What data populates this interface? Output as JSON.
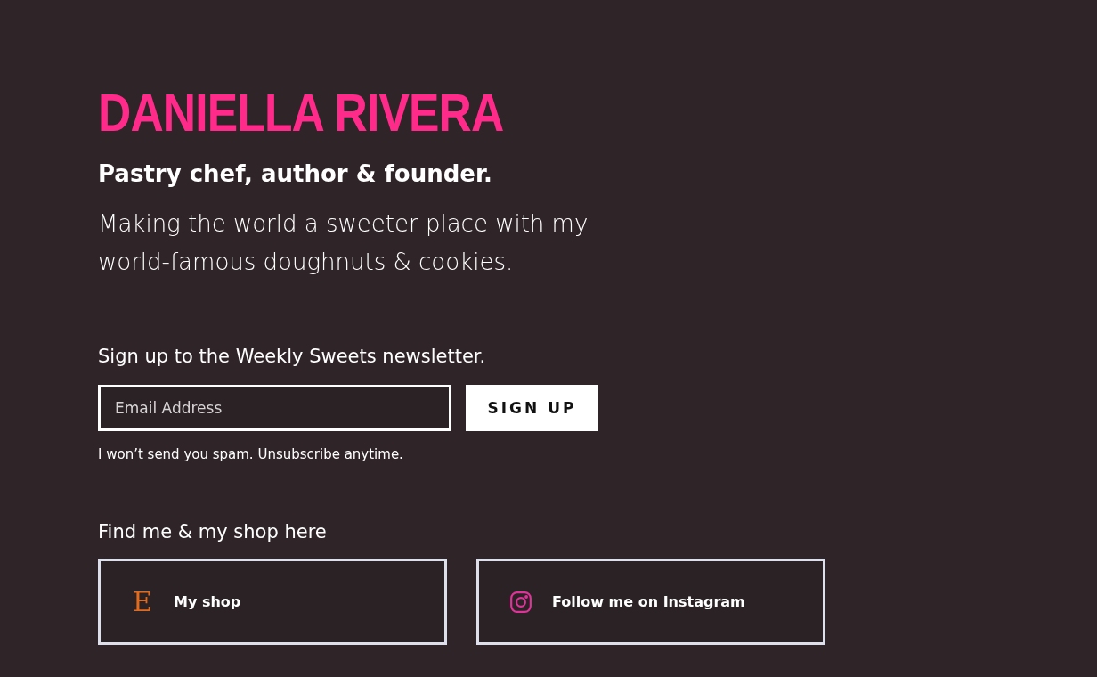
{
  "name": "DANIELLA RIVERA",
  "tagline": "Pastry chef, author & founder.",
  "description": "Making the world a sweeter place with my world-famous doughnuts & cookies.",
  "newsletter": {
    "label": "Sign up to the Weekly Sweets newsletter.",
    "placeholder": "Email Address",
    "button": "SIGN UP",
    "note": "I won’t send you spam. Unsubscribe anytime."
  },
  "links": {
    "heading": "Find me & my shop here",
    "items": [
      {
        "kind": "shop",
        "glyph": "E",
        "label": "My shop"
      },
      {
        "kind": "instagram",
        "label": "Follow me on Instagram"
      }
    ]
  }
}
